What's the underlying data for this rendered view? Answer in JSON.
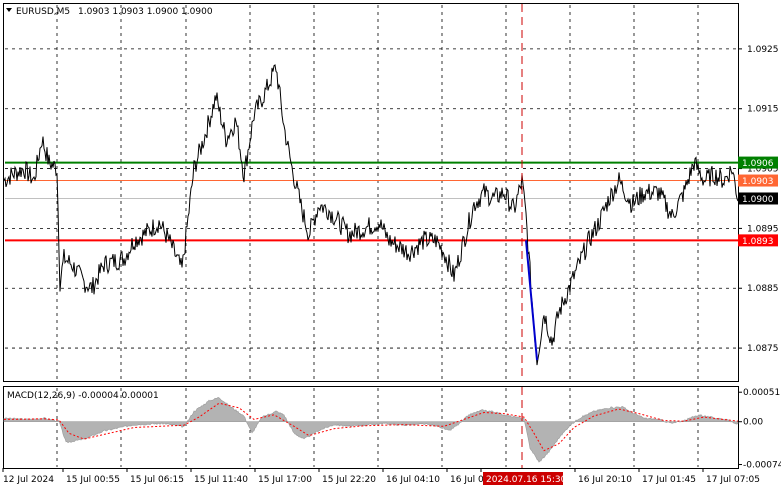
{
  "chart_data": [
    {
      "type": "line",
      "title": "EURUSD,M5",
      "ohlc": [
        "1.0903",
        "1.0903",
        "1.0900",
        "1.0900"
      ],
      "ylim": [
        1.08695,
        1.09325
      ],
      "grid": true,
      "y_ticks": [
        "1.0925",
        "1.0915",
        "1.0905",
        "1.0895",
        "1.0885",
        "1.0875"
      ],
      "x_ticks": [
        "12 Jul 2024",
        "15 Jul 00:55",
        "15 Jul 06:15",
        "15 Jul 11:40",
        "15 Jul 17:00",
        "15 Jul 22:20",
        "16 Jul 04:10",
        "16 Jul 0",
        "2024.07.16 15:30",
        "16 Jul 20:10",
        "17 Jul 01:45",
        "17 Jul 07:05"
      ],
      "levels": [
        {
          "value": 1.0906,
          "label": "1.0906",
          "color": "#008000"
        },
        {
          "value": 1.0903,
          "label": "1.0903",
          "color": "#ff6633"
        },
        {
          "value": 1.09,
          "label": "1.0900",
          "color": "#000000"
        },
        {
          "value": 1.0893,
          "label": "1.0893",
          "color": "#ff0000"
        }
      ],
      "price_keypoints": [
        [
          0,
          1.0903
        ],
        [
          8,
          1.0904
        ],
        [
          20,
          1.0905
        ],
        [
          30,
          1.0903
        ],
        [
          38,
          1.091
        ],
        [
          45,
          1.0906
        ],
        [
          53,
          1.0905
        ],
        [
          56,
          1.0886
        ],
        [
          60,
          1.089
        ],
        [
          68,
          1.0889
        ],
        [
          80,
          1.0886
        ],
        [
          88,
          1.0885
        ],
        [
          100,
          1.0889
        ],
        [
          120,
          1.089
        ],
        [
          130,
          1.0893
        ],
        [
          140,
          1.0894
        ],
        [
          155,
          1.0896
        ],
        [
          165,
          1.0893
        ],
        [
          178,
          1.0888
        ],
        [
          190,
          1.0905
        ],
        [
          200,
          1.091
        ],
        [
          212,
          1.0917
        ],
        [
          222,
          1.091
        ],
        [
          232,
          1.0913
        ],
        [
          240,
          1.0904
        ],
        [
          250,
          1.0914
        ],
        [
          262,
          1.0918
        ],
        [
          272,
          1.0922
        ],
        [
          280,
          1.0912
        ],
        [
          288,
          1.0905
        ],
        [
          298,
          1.0898
        ],
        [
          305,
          1.0894
        ],
        [
          315,
          1.0899
        ],
        [
          325,
          1.0898
        ],
        [
          335,
          1.0896
        ],
        [
          345,
          1.0894
        ],
        [
          360,
          1.0895
        ],
        [
          375,
          1.0896
        ],
        [
          385,
          1.0893
        ],
        [
          395,
          1.0892
        ],
        [
          405,
          1.0891
        ],
        [
          420,
          1.0893
        ],
        [
          432,
          1.0893
        ],
        [
          440,
          1.0891
        ],
        [
          450,
          1.0887
        ],
        [
          460,
          1.0893
        ],
        [
          470,
          1.0899
        ],
        [
          480,
          1.0901
        ],
        [
          490,
          1.09
        ],
        [
          500,
          1.0901
        ],
        [
          510,
          1.0898
        ],
        [
          518,
          1.0903
        ],
        [
          522,
          1.0897
        ],
        [
          528,
          1.0883
        ],
        [
          533,
          1.0873
        ],
        [
          540,
          1.0881
        ],
        [
          548,
          1.0876
        ],
        [
          555,
          1.0881
        ],
        [
          565,
          1.0885
        ],
        [
          575,
          1.0889
        ],
        [
          585,
          1.0893
        ],
        [
          595,
          1.0896
        ],
        [
          605,
          1.09
        ],
        [
          615,
          1.0903
        ],
        [
          628,
          1.0899
        ],
        [
          640,
          1.0901
        ],
        [
          655,
          1.0901
        ],
        [
          668,
          1.0897
        ],
        [
          680,
          1.0901
        ],
        [
          690,
          1.0906
        ],
        [
          700,
          1.0903
        ],
        [
          710,
          1.0904
        ],
        [
          720,
          1.0903
        ],
        [
          728,
          1.0905
        ],
        [
          734,
          1.09
        ]
      ],
      "arrow": {
        "from": [
          522,
          1.0893
        ],
        "to": [
          533,
          1.0873
        ],
        "color": "#0000cc"
      },
      "event_marker": {
        "x_label": "2024.07.16 15:30",
        "color": "#cc0000"
      }
    },
    {
      "type": "area",
      "title": "MACD(12,26,9) -0.00004 0.00001",
      "ylim": [
        -0.0008,
        0.0006
      ],
      "y_ticks": [
        "0.00051",
        "0.00",
        "-0.00074"
      ],
      "zero": 0.0,
      "histogram_keypoints": [
        [
          0,
          6e-05
        ],
        [
          25,
          4e-05
        ],
        [
          40,
          6e-05
        ],
        [
          55,
          1e-05
        ],
        [
          62,
          -0.00036
        ],
        [
          80,
          -0.0003
        ],
        [
          100,
          -0.00016
        ],
        [
          130,
          -5e-05
        ],
        [
          160,
          -3e-05
        ],
        [
          180,
          -9e-05
        ],
        [
          190,
          0.00018
        ],
        [
          205,
          0.00036
        ],
        [
          215,
          0.00042
        ],
        [
          225,
          0.00028
        ],
        [
          240,
          0.0001
        ],
        [
          248,
          -0.0002
        ],
        [
          258,
          8e-05
        ],
        [
          272,
          0.00018
        ],
        [
          280,
          0.00012
        ],
        [
          290,
          -0.0002
        ],
        [
          300,
          -0.0003
        ],
        [
          315,
          -0.00015
        ],
        [
          330,
          -5e-05
        ],
        [
          345,
          -8e-05
        ],
        [
          360,
          -6e-05
        ],
        [
          380,
          -3e-05
        ],
        [
          400,
          -6e-05
        ],
        [
          420,
          -4e-05
        ],
        [
          435,
          -8e-05
        ],
        [
          445,
          -0.00016
        ],
        [
          455,
          -4e-05
        ],
        [
          465,
          0.00012
        ],
        [
          478,
          0.0002
        ],
        [
          488,
          0.00018
        ],
        [
          500,
          0.00012
        ],
        [
          512,
          8e-05
        ],
        [
          520,
          5e-05
        ],
        [
          526,
          -0.00045
        ],
        [
          535,
          -0.0007
        ],
        [
          545,
          -0.00052
        ],
        [
          555,
          -0.00028
        ],
        [
          565,
          -8e-05
        ],
        [
          575,
          6e-05
        ],
        [
          590,
          0.00018
        ],
        [
          605,
          0.00024
        ],
        [
          618,
          0.00026
        ],
        [
          628,
          0.00016
        ],
        [
          640,
          6e-05
        ],
        [
          655,
          4e-05
        ],
        [
          668,
          -3e-05
        ],
        [
          680,
          2e-05
        ],
        [
          695,
          0.00012
        ],
        [
          705,
          8e-05
        ],
        [
          715,
          6e-05
        ],
        [
          725,
          2e-05
        ],
        [
          734,
          -4e-05
        ]
      ],
      "signal_keypoints": [
        [
          0,
          4e-05
        ],
        [
          40,
          5e-05
        ],
        [
          55,
          3e-05
        ],
        [
          65,
          -0.0002
        ],
        [
          80,
          -0.0003
        ],
        [
          100,
          -0.00022
        ],
        [
          130,
          -0.0001
        ],
        [
          180,
          -6e-05
        ],
        [
          195,
          8e-05
        ],
        [
          215,
          0.00032
        ],
        [
          235,
          0.00024
        ],
        [
          250,
          4e-05
        ],
        [
          270,
          0.00012
        ],
        [
          290,
          -8e-05
        ],
        [
          305,
          -0.00024
        ],
        [
          330,
          -0.00012
        ],
        [
          360,
          -7e-05
        ],
        [
          400,
          -5e-05
        ],
        [
          440,
          -8e-05
        ],
        [
          460,
          4e-05
        ],
        [
          480,
          0.00016
        ],
        [
          500,
          0.00014
        ],
        [
          520,
          8e-05
        ],
        [
          530,
          -0.0002
        ],
        [
          540,
          -0.0005
        ],
        [
          555,
          -0.00038
        ],
        [
          570,
          -0.0001
        ],
        [
          590,
          0.0001
        ],
        [
          615,
          0.00022
        ],
        [
          635,
          0.00014
        ],
        [
          660,
          2e-05
        ],
        [
          680,
          1e-05
        ],
        [
          700,
          8e-05
        ],
        [
          734,
          1e-05
        ]
      ]
    }
  ]
}
